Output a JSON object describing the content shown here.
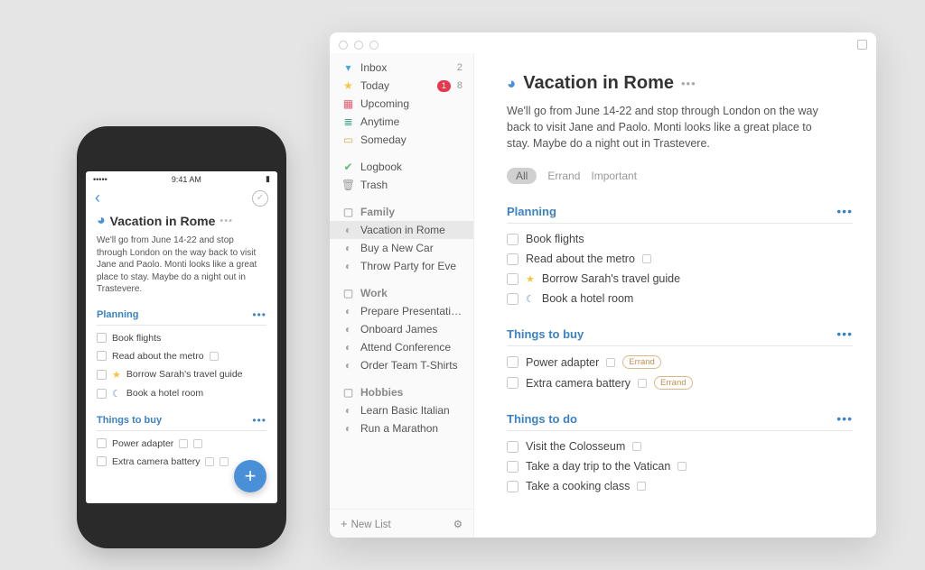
{
  "phone": {
    "statusLeft": "•••••",
    "statusTime": "9:41 AM",
    "title": "Vacation in Rome",
    "moreGlyph": "•••",
    "desc": "We'll go from June 14-22 and stop through London on the way back to visit Jane and Paolo. Monti looks like a great place to stay. Maybe do a night out in Trastevere.",
    "sections": [
      {
        "title": "Planning",
        "tasks": [
          {
            "label": "Book flights"
          },
          {
            "label": "Read about the metro",
            "list": true
          },
          {
            "label": "Borrow Sarah's travel guide",
            "star": true
          },
          {
            "label": "Book a hotel room",
            "moon": true
          }
        ]
      },
      {
        "title": "Things to buy",
        "tasks": [
          {
            "label": "Power adapter",
            "list": true,
            "list2": true
          },
          {
            "label": "Extra camera battery",
            "list": true,
            "list2": true
          }
        ]
      }
    ],
    "fab": "+"
  },
  "desktop": {
    "sidebar": {
      "top": [
        {
          "icon": "inbox",
          "label": "Inbox",
          "count": "2"
        },
        {
          "icon": "today",
          "label": "Today",
          "badge": "1",
          "count": "8"
        },
        {
          "icon": "upcoming",
          "label": "Upcoming"
        },
        {
          "icon": "anytime",
          "label": "Anytime"
        },
        {
          "icon": "someday",
          "label": "Someday"
        }
      ],
      "mid": [
        {
          "icon": "logbook",
          "label": "Logbook"
        },
        {
          "icon": "trash",
          "label": "Trash"
        }
      ],
      "areas": [
        {
          "name": "Family",
          "projects": [
            {
              "label": "Vacation in Rome",
              "selected": true
            },
            {
              "label": "Buy a New Car"
            },
            {
              "label": "Throw Party for Eve"
            }
          ]
        },
        {
          "name": "Work",
          "projects": [
            {
              "label": "Prepare Presentation"
            },
            {
              "label": "Onboard James"
            },
            {
              "label": "Attend Conference"
            },
            {
              "label": "Order Team T-Shirts"
            }
          ]
        },
        {
          "name": "Hobbies",
          "projects": [
            {
              "label": "Learn Basic Italian"
            },
            {
              "label": "Run a Marathon"
            }
          ]
        }
      ],
      "newList": "New List"
    },
    "main": {
      "title": "Vacation in Rome",
      "moreGlyph": "•••",
      "desc": "We'll go from June 14-22 and stop through London on the way back to visit Jane and Paolo. Monti looks like a great place to stay. Maybe do a night out in Trastevere.",
      "filters": [
        "All",
        "Errand",
        "Important"
      ],
      "sections": [
        {
          "title": "Planning",
          "tasks": [
            {
              "label": "Book flights"
            },
            {
              "label": "Read about the metro",
              "list": true
            },
            {
              "label": "Borrow Sarah's travel guide",
              "star": true
            },
            {
              "label": "Book a hotel room",
              "moon": true
            }
          ]
        },
        {
          "title": "Things to buy",
          "tasks": [
            {
              "label": "Power adapter",
              "list": true,
              "tag": "Errand"
            },
            {
              "label": "Extra camera battery",
              "list": true,
              "tag": "Errand"
            }
          ]
        },
        {
          "title": "Things to do",
          "tasks": [
            {
              "label": "Visit the Colosseum",
              "list": true
            },
            {
              "label": "Take a day trip to the Vatican",
              "list": true
            },
            {
              "label": "Take a cooking class",
              "list": true
            }
          ]
        }
      ]
    }
  }
}
